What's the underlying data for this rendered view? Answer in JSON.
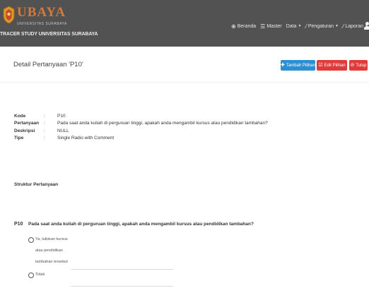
{
  "header": {
    "brand_name": "UBAYA",
    "brand_sub": "UNIVERSITAS SURABAYA",
    "app_title": "TRACER STUDY UNIVERSITAS SURABAYA",
    "background": "#525252",
    "brand_color": "#d27a3c",
    "nav": [
      {
        "label": "Beranda",
        "icon": "globe-icon"
      },
      {
        "label": "Master",
        "icon": "list-icon"
      },
      {
        "label": "Data",
        "icon": "",
        "dropdown": true
      },
      {
        "label": "Pengaturan",
        "icon": "wrench-icon",
        "dropdown": true
      },
      {
        "label": "Laporan",
        "icon": "wrench-icon",
        "dropdown": true
      }
    ]
  },
  "page": {
    "title": "Detail Pertanyaan 'P10'",
    "buttons": {
      "add_option": "Tambah Pilihan",
      "edit_option": "Edit Pilihan",
      "close": "Tutup"
    },
    "button_colors": {
      "primary": "#2d8fd3",
      "danger": "#e03a3a"
    }
  },
  "details": [
    {
      "label": "Kode",
      "value": "P10"
    },
    {
      "label": "Pertanyaan",
      "value": "Pada saat anda kuliah di perguruan tinggi, apakah anda mengambil kursus atau pendidikan tambahan?"
    },
    {
      "label": "Deskripsi",
      "value": "NULL"
    },
    {
      "label": "Tipe",
      "value": "Single Radio with Comment"
    }
  ],
  "structure": {
    "section_title": "Struktur Pertanyaan",
    "question_code": "P10",
    "question_text": "Pada saat anda kuliah di perguruan tinggi, apakah anda mengambil kursus atau pendidikan tambahan?",
    "options": [
      {
        "label_lines": [
          "Ya, tuliskan kursus",
          "atau pendidikan",
          "tambahan tersebut"
        ],
        "comment_value": ""
      },
      {
        "label_lines": [
          "Tidak"
        ],
        "comment_value": ""
      }
    ]
  }
}
